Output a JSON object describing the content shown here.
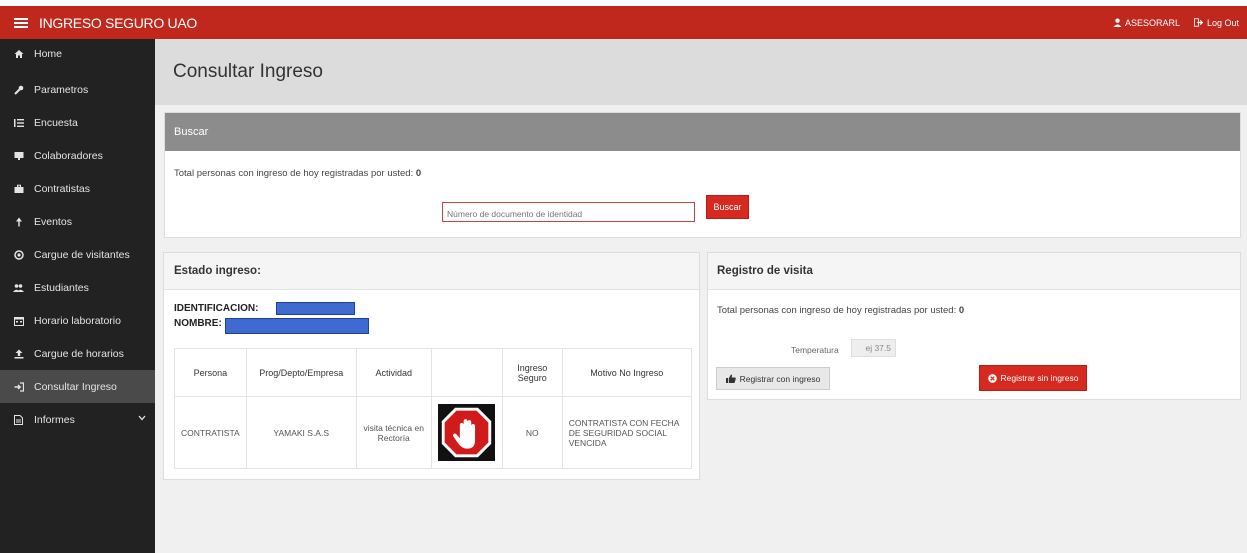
{
  "topbar": {
    "brand": "INGRESO SEGURO UAO",
    "user": "ASESORARL",
    "logout": "Log Out"
  },
  "sidebar": {
    "items": [
      {
        "label": "Home",
        "icon": "home-icon"
      },
      {
        "label": "Parametros",
        "icon": "wrench-icon"
      },
      {
        "label": "Encuesta",
        "icon": "list-icon"
      },
      {
        "label": "Colaboradores",
        "icon": "display-icon"
      },
      {
        "label": "Contratistas",
        "icon": "briefcase-icon"
      },
      {
        "label": "Eventos",
        "icon": "pin-icon"
      },
      {
        "label": "Cargue de visitantes",
        "icon": "circle-dot-icon"
      },
      {
        "label": "Estudiantes",
        "icon": "users-icon"
      },
      {
        "label": "Horario laboratorio",
        "icon": "calendar-icon"
      },
      {
        "label": "Cargue de horarios",
        "icon": "upload-icon"
      },
      {
        "label": "Consultar Ingreso",
        "icon": "sign-in-icon"
      },
      {
        "label": "Informes",
        "icon": "file-icon"
      }
    ]
  },
  "page": {
    "title": "Consultar Ingreso"
  },
  "buscar": {
    "header": "Buscar",
    "total_label": "Total personas con ingreso de hoy registradas por usted: ",
    "total_value": "0",
    "input_placeholder": "Número de documento de identidad",
    "button": "Buscar"
  },
  "estado": {
    "header": "Estado ingreso:",
    "identificacion_label": "IDENTIFICACION:",
    "nombre_label": "NOMBRE:",
    "columns": [
      "Persona",
      "Prog/Depto/Empresa",
      "Actividad",
      "",
      "Ingreso Seguro",
      "Motivo No Ingreso"
    ],
    "row": {
      "persona": "CONTRATISTA",
      "empresa": "YAMAKI S.A.S",
      "actividad": "visita técnica en Rectoría",
      "ingreso_seguro": "NO",
      "motivo": "CONTRATISTA CON FECHA DE SEGURIDAD SOCIAL VENCIDA"
    }
  },
  "registro": {
    "header": "Registro de visita",
    "total_label": "Total personas con ingreso de hoy registradas por usted: ",
    "total_value": "0",
    "temp_label": "Temperatura",
    "temp_placeholder": "ej 37.5",
    "btn_con": "Registrar con ingreso",
    "btn_sin": "Registrar sin ingreso"
  },
  "colors": {
    "brand_red": "#c0281e",
    "sidebar_bg": "#222222",
    "redaction_blue": "#3f6bd0"
  }
}
